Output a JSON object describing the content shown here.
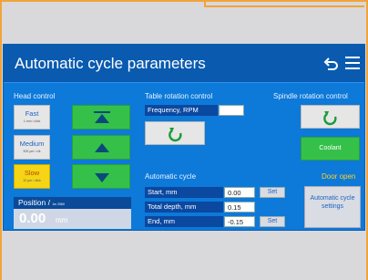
{
  "title": "Automatic cycle parameters",
  "head_control": {
    "heading": "Head control",
    "speeds": [
      {
        "label": "Fast",
        "sub": "1 mm / click",
        "active": false
      },
      {
        "label": "Medium",
        "sub": "500 µm / clk",
        "active": false
      },
      {
        "label": "Slow",
        "sub": "10 µm / click",
        "active": true
      }
    ],
    "arrows": [
      "top-icon",
      "up-icon",
      "down-icon"
    ]
  },
  "position": {
    "label": "Position / ",
    "unit_note": "1m 2060",
    "value": "0.00",
    "unit": "mm"
  },
  "table_rotation": {
    "heading": "Table rotation control",
    "freq_label": "Frequency, RPM",
    "freq_value": ""
  },
  "spindle": {
    "heading": "Spindle rotation control",
    "coolant_label": "Coolant",
    "door_status": "Door open"
  },
  "auto_cycle": {
    "heading": "Automatic cycle",
    "rows": [
      {
        "label": "Start, mm",
        "value": "0.00",
        "set": "Set"
      },
      {
        "label": "Total depth, mm",
        "value": "0.15",
        "set": ""
      },
      {
        "label": "End, mm",
        "value": "-0.15",
        "set": "Set"
      }
    ],
    "settings_btn": "Automatic cycle settings"
  },
  "colors": {
    "screen": "#0d79d9",
    "titlebar": "#0a5bb0",
    "green": "#35c04a",
    "yellow": "#f5d515",
    "frame": "#f2a33a"
  }
}
